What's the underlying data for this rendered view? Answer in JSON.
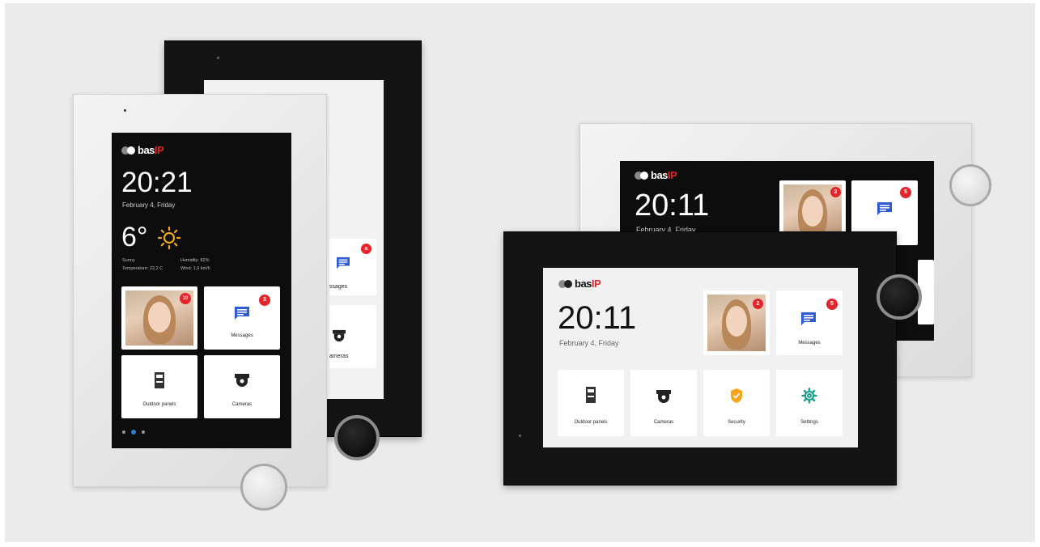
{
  "brand": {
    "name": "bas",
    "suffix": "IP"
  },
  "devices": {
    "vertical_white": {
      "time": "20:21",
      "date": "February 4, Friday",
      "weather": {
        "temp": "6°",
        "condition": "Sunny",
        "temperature_line": "Temperature: 22,2 C",
        "humidity_line": "Humidity: 82%",
        "wind_line": "Wind: 1,9 km/h"
      },
      "tiles": [
        {
          "label": "",
          "badge": "10",
          "icon": "visitor-photo"
        },
        {
          "label": "Messages",
          "badge": "3",
          "icon": "message-icon"
        },
        {
          "label": "Outdoor panels",
          "badge": "",
          "icon": "outdoor-panel-icon"
        },
        {
          "label": "Cameras",
          "badge": "",
          "icon": "camera-icon"
        }
      ],
      "page_dots": 3,
      "active_dot": 1
    },
    "vertical_black": {
      "tiles": [
        {
          "label": "ssages",
          "badge": "a",
          "icon": "message-icon"
        },
        {
          "label": "ameras",
          "badge": "",
          "icon": "camera-icon"
        }
      ]
    },
    "horizontal_white": {
      "time": "20:11",
      "date": "February 4, Friday",
      "tiles": [
        {
          "label": "",
          "badge": "2",
          "icon": "visitor-photo"
        },
        {
          "label": "",
          "badge": "5",
          "icon": "message-icon"
        }
      ]
    },
    "horizontal_black": {
      "time": "20:11",
      "date": "February 4, Friday",
      "tiles": [
        {
          "label": "",
          "badge": "2",
          "icon": "visitor-photo"
        },
        {
          "label": "Messages",
          "badge": "5",
          "icon": "message-icon"
        },
        {
          "label": "Outdoor panels",
          "badge": "",
          "icon": "outdoor-panel-icon"
        },
        {
          "label": "Cameras",
          "badge": "",
          "icon": "camera-icon"
        },
        {
          "label": "Security",
          "badge": "",
          "icon": "shield-check-icon"
        },
        {
          "label": "Settings",
          "badge": "",
          "icon": "gear-icon"
        }
      ]
    }
  },
  "colors": {
    "badge": "#e3262b",
    "message_icon": "#2f5bd0",
    "security_icon": "#f4a51c",
    "settings_icon": "#1a9c8c",
    "weather_sun": "#f4a51c",
    "active_dot": "#2f7fd6"
  }
}
